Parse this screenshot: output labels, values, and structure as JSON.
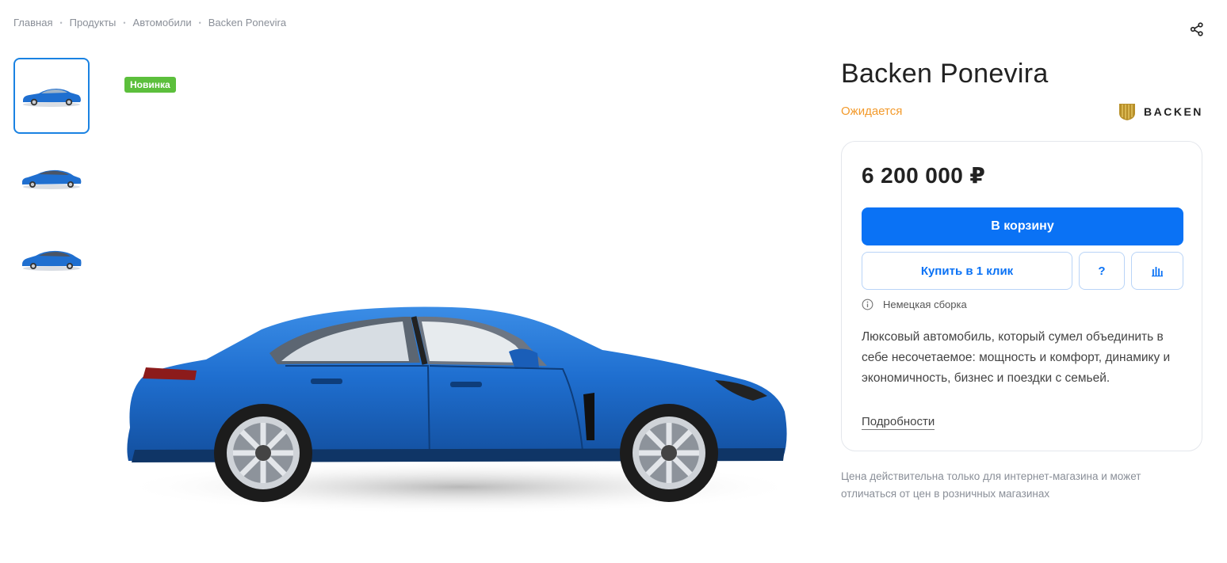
{
  "breadcrumb": {
    "items": [
      "Главная",
      "Продукты",
      "Автомобили",
      "Backen Ponevira"
    ],
    "separator": "•"
  },
  "share": {
    "icon": "share-icon"
  },
  "gallery": {
    "thumbnails": [
      {
        "icon": "car-thumbnail-side",
        "active": true
      },
      {
        "icon": "car-thumbnail-front-quarter",
        "active": false
      },
      {
        "icon": "car-thumbnail-rear-quarter",
        "active": false
      }
    ],
    "badge": "Новинка",
    "main_image": "car-side-view"
  },
  "product": {
    "title": "Backen Ponevira",
    "status": "Ожидается",
    "brand": {
      "name": "BACKEN",
      "logo": "backen-shield-logo"
    },
    "price": "6 200 000 ₽",
    "buttons": {
      "cart": "В корзину",
      "one_click": "Купить в 1 клик",
      "question": "?",
      "compare_icon": "bar-chart-icon"
    },
    "note": {
      "icon": "info-icon",
      "text": "Немецкая сборка"
    },
    "description": "Люксовый автомобиль, который сумел объединить в себе несочетаемое: мощность и комфорт, динамику и экономичность, бизнес и поездки с семьей.",
    "more_link": "Подробности",
    "disclaimer": "Цена действительна только для интернет-магазина и может отличаться от цен в розничных магазинах"
  },
  "colors": {
    "accent": "#0a72f5",
    "badge_green": "#5cbf3c",
    "status_orange": "#f39a2b",
    "car_blue": "#1f6fd0"
  }
}
